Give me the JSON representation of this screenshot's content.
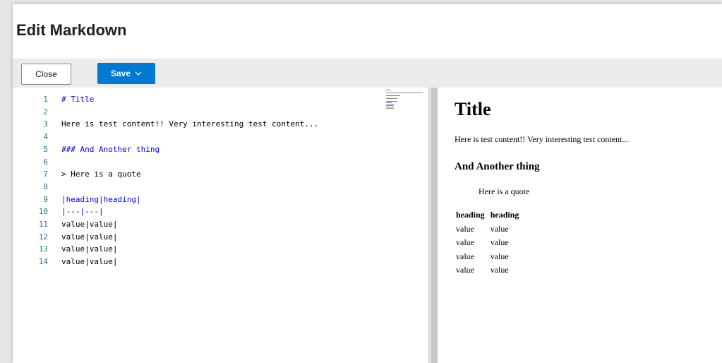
{
  "dialog": {
    "title": "Edit Markdown"
  },
  "toolbar": {
    "close_label": "Close",
    "save_label": "Save",
    "save_icon": "chevron-down-icon",
    "save_color": "#0078d4"
  },
  "editor": {
    "lines": [
      {
        "n": "1",
        "text": "# Title",
        "blue": true
      },
      {
        "n": "2",
        "text": "",
        "blue": false
      },
      {
        "n": "3",
        "text": "Here is test content!! Very interesting test content...",
        "blue": false
      },
      {
        "n": "4",
        "text": "",
        "blue": false
      },
      {
        "n": "5",
        "text": "### And Another thing",
        "blue": true
      },
      {
        "n": "6",
        "text": "",
        "blue": false
      },
      {
        "n": "7",
        "text": "> Here is a quote",
        "blue": false
      },
      {
        "n": "8",
        "text": "",
        "blue": false
      },
      {
        "n": "9",
        "text": "|heading|heading|",
        "blue": true
      },
      {
        "n": "10",
        "text": "|---|---|",
        "blue": true
      },
      {
        "n": "11",
        "text": "value|value|",
        "blue": false
      },
      {
        "n": "12",
        "text": "value|value|",
        "blue": false
      },
      {
        "n": "13",
        "text": "value|value|",
        "blue": false
      },
      {
        "n": "14",
        "text": "value|value|",
        "blue": false
      }
    ],
    "line_number_color": "#237893",
    "markup_color": "#0000ff"
  },
  "preview": {
    "h1": "Title",
    "paragraph": "Here is test content!! Very interesting test content...",
    "h3": "And Another thing",
    "quote": "Here is a quote",
    "table": {
      "headers": [
        "heading",
        "heading"
      ],
      "rows": [
        [
          "value",
          "value"
        ],
        [
          "value",
          "value"
        ],
        [
          "value",
          "value"
        ],
        [
          "value",
          "value"
        ]
      ]
    }
  }
}
